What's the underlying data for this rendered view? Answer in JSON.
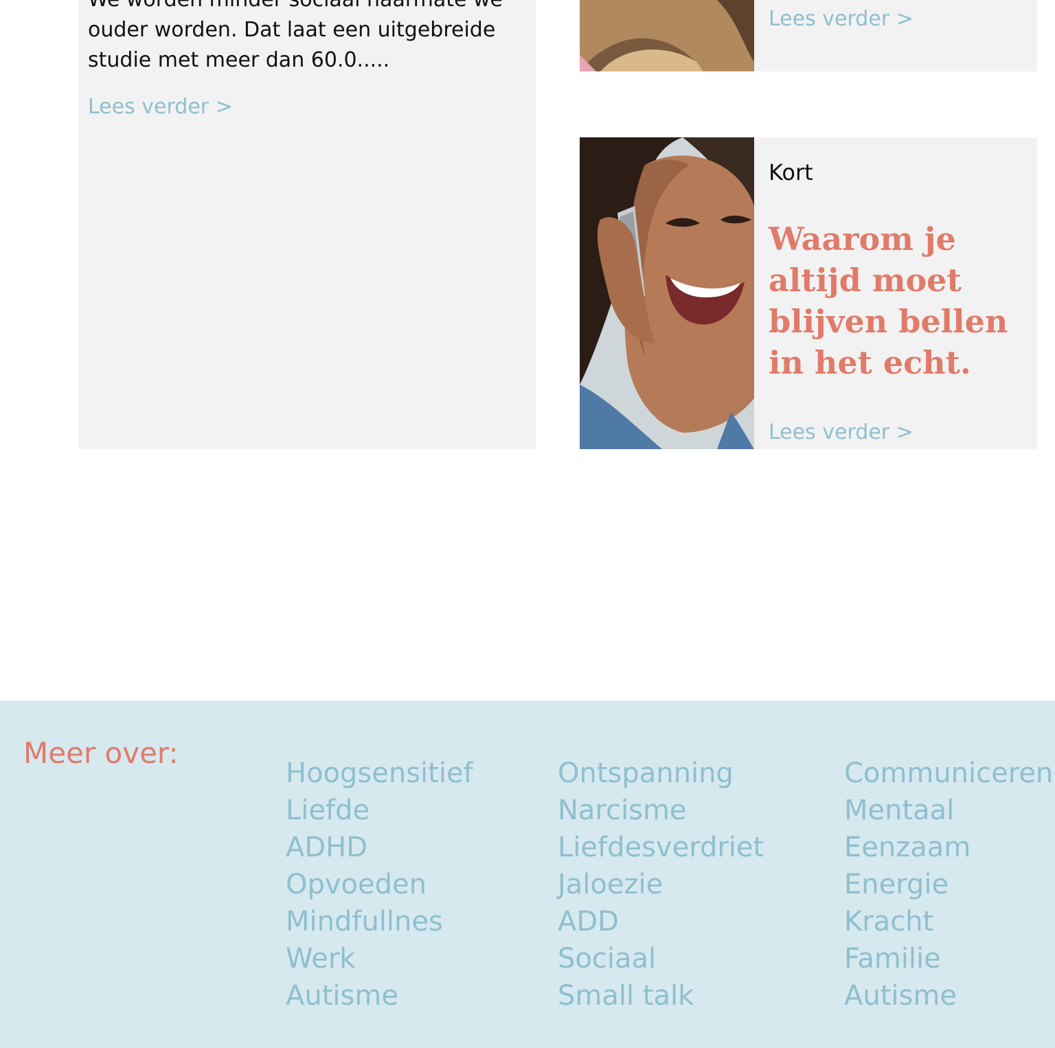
{
  "articles": {
    "left": {
      "excerpt": "We worden minder sociaal naarmate we ouder worden. Dat laat een uitgebreide studie met meer dan 60.0.....",
      "read_more": "Lees verder >"
    },
    "right_top": {
      "read_more": "Lees verder >"
    },
    "right": {
      "category": "Kort",
      "headline": "Waarom je altijd moet blijven bellen in het echt.",
      "read_more": "Lees verder >"
    }
  },
  "footer": {
    "title": "Meer over:",
    "columns": [
      [
        "Hoogsensitief",
        "Liefde",
        "ADHD",
        "Opvoeden",
        "Mindfullnes",
        "Werk",
        "Autisme"
      ],
      [
        "Ontspanning",
        "Narcisme",
        "Liefdesverdriet",
        "Jaloezie",
        "ADD",
        "Sociaal",
        "Small talk"
      ],
      [
        "Communiceren",
        "Mentaal",
        "Eenzaam",
        "Energie",
        "Kracht",
        "Familie",
        "Autisme"
      ]
    ]
  },
  "colors": {
    "accent_coral": "#e07b6a",
    "link_blue": "#8fbfcf",
    "card_bg": "#f2f2f2",
    "footer_bg": "#d6e9ef"
  }
}
